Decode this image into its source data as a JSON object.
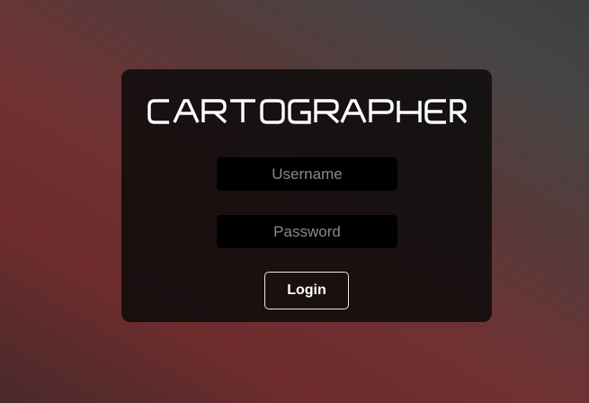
{
  "brand": {
    "logo_text": "CARTOGRAPHER",
    "logo_color": "#ffffff"
  },
  "form": {
    "username": {
      "value": "",
      "placeholder": "Username"
    },
    "password": {
      "value": "",
      "placeholder": "Password"
    },
    "login_label": "Login"
  },
  "colors": {
    "panel": "#0c0a0a",
    "field_bg": "#000000",
    "accent_red": "#6e2c2d",
    "button_border": "#e8e8e8"
  }
}
